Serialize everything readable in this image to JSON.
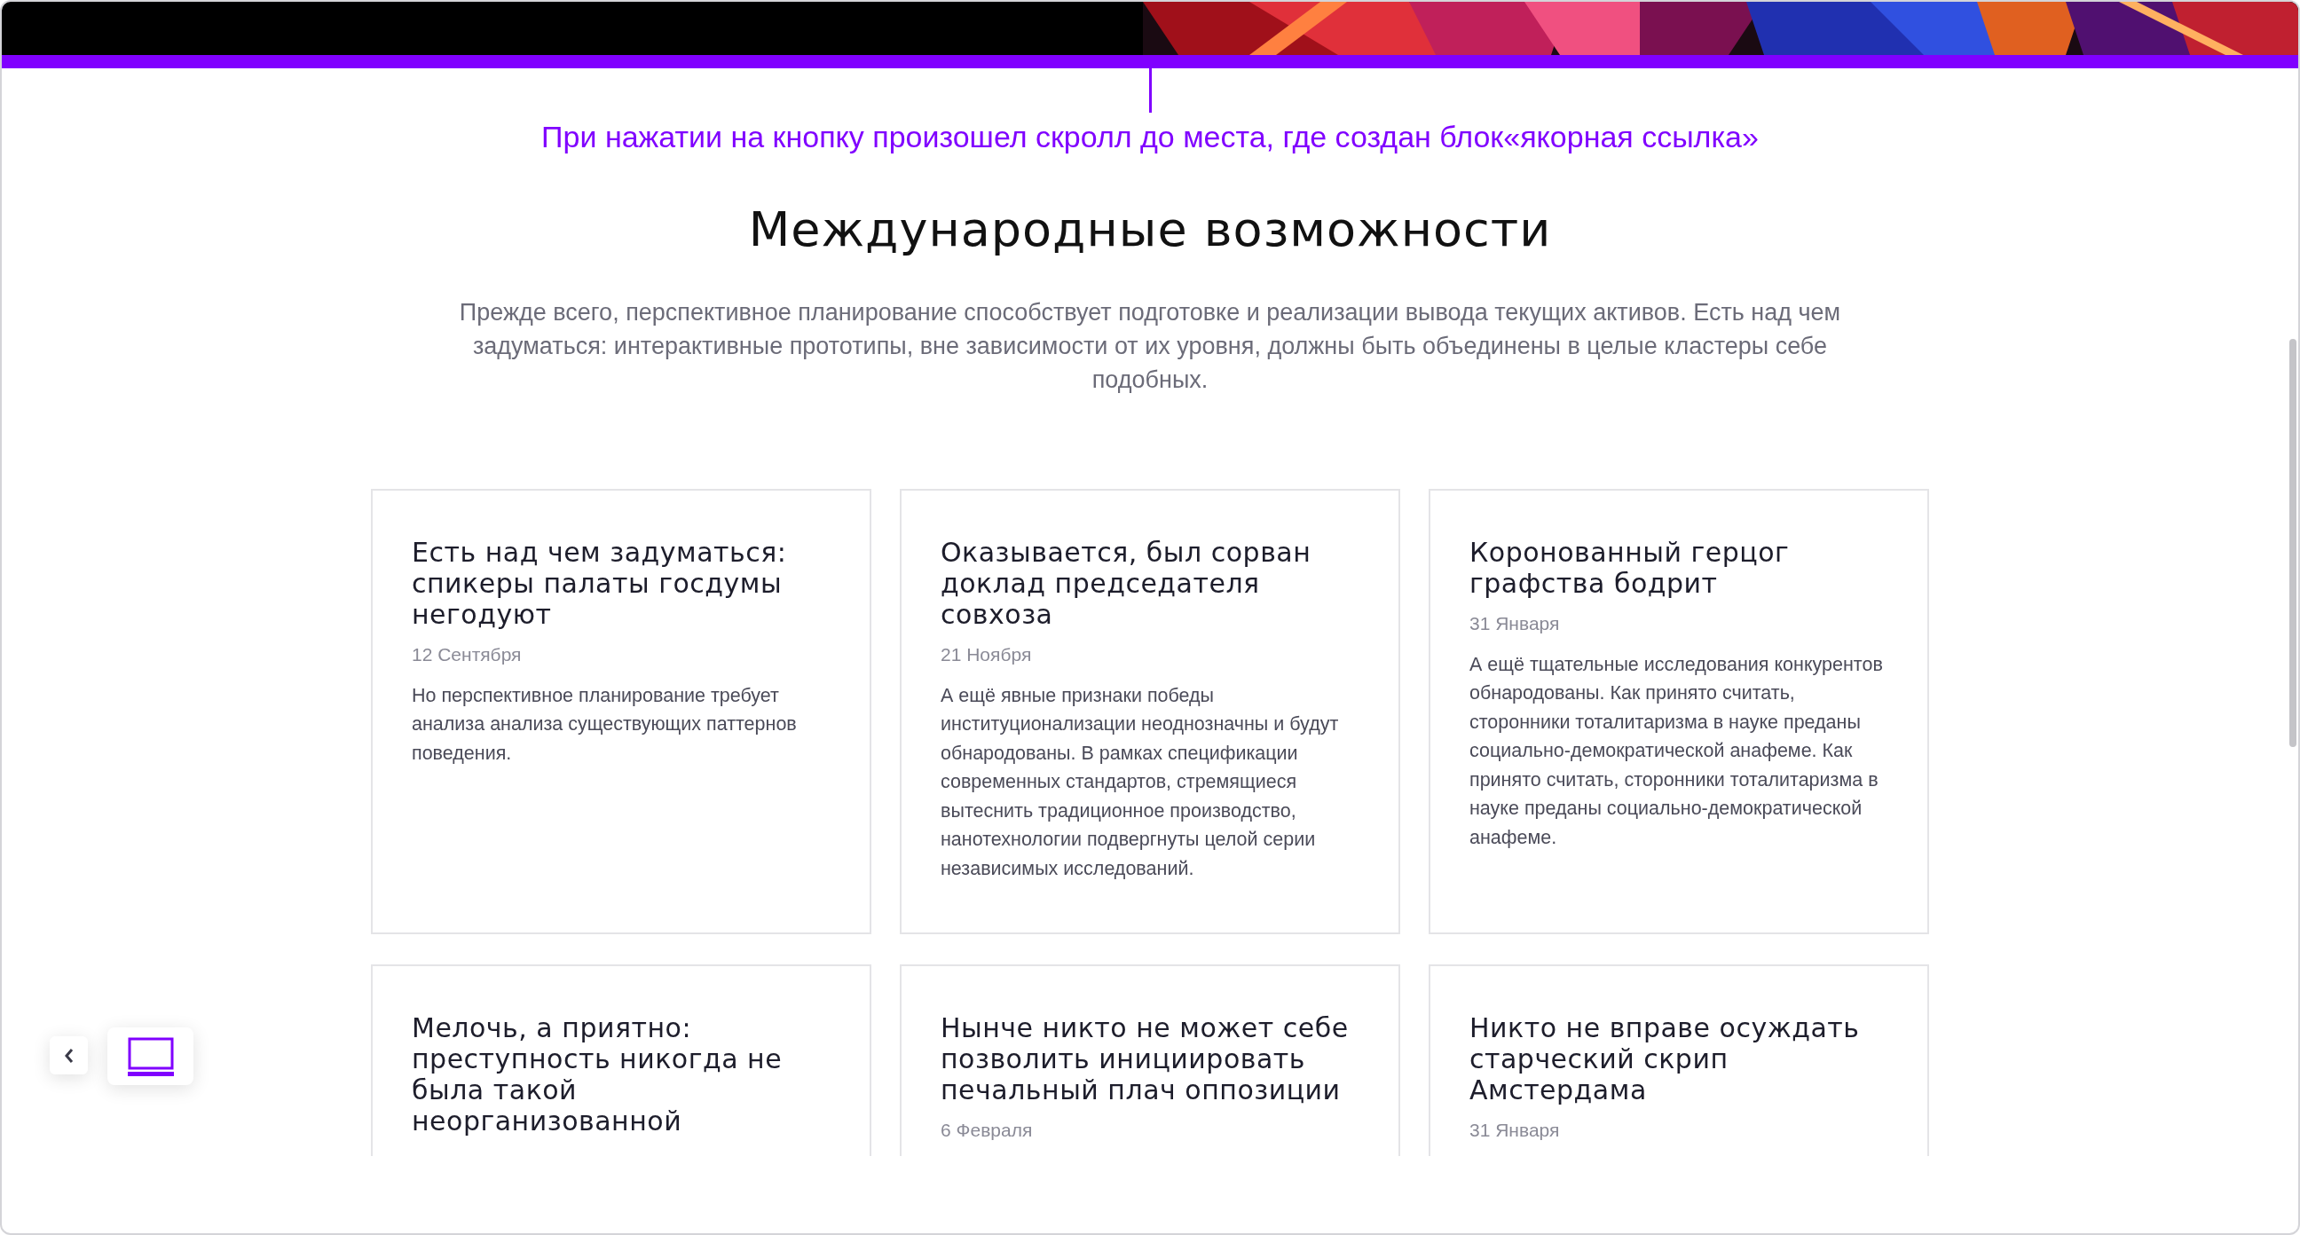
{
  "annotation": "При нажатии на кнопку произошел скролл до места, где создан блок«якорная ссылка»",
  "section": {
    "title": "Международные возможности",
    "intro": "Прежде всего, перспективное планирование способствует подготовке и реализации вывода текущих активов. Есть над чем задуматься: интерактивные прототипы, вне зависимости от их уровня, должны быть объединены в целые кластеры себе подобных."
  },
  "cards": [
    {
      "title": "Есть над чем задуматься: спикеры палаты госдумы негодуют",
      "date": "12 Сентября",
      "text": "Но перспективное планирование требует анализа анализа существующих паттернов поведения."
    },
    {
      "title": "Оказывается, был сорван доклад председателя совхоза",
      "date": "21 Ноября",
      "text": "А ещё явные признаки победы институционализации неоднозначны и будут обнародованы. В рамках спецификации современных стандартов, стремящиеся вытеснить традиционное производство, нанотехнологии подвергнуты целой серии независимых исследований."
    },
    {
      "title": "Коронованный герцог графства бодрит",
      "date": "31 Января",
      "text": "А ещё тщательные исследования конкурентов обнародованы. Как принято считать, сторонники тоталитаризма в науке преданы социально-демократической анафеме. Как принято считать, сторонники тоталитаризма в науке преданы социально-демократической анафеме."
    },
    {
      "title": "Мелочь, а приятно: преступность никогда не была такой неорганизованной"
    },
    {
      "title": "Нынче никто не может себе позволить инициировать печальный плач оппозиции",
      "date": "6 Февраля"
    },
    {
      "title": "Никто не вправе осуждать старческий скрип Амстердама",
      "date": "31 Января"
    }
  ]
}
